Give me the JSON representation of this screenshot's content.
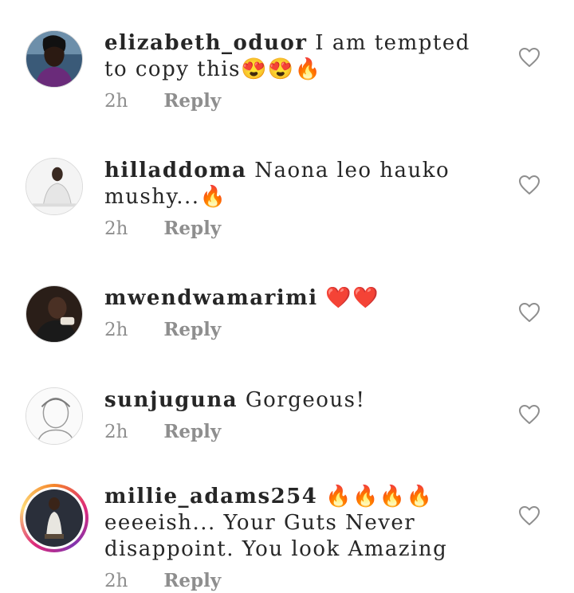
{
  "comments": [
    {
      "username": "elizabeth_oduor",
      "text": "I am tempted to copy this😍😍🔥",
      "time": "2h",
      "reply_label": "Reply",
      "avatar_icon": "profile-photo"
    },
    {
      "username": "hilladdoma",
      "text": "Naona leo hauko mushy...🔥",
      "time": "2h",
      "reply_label": "Reply",
      "avatar_icon": "profile-photo"
    },
    {
      "username": "mwendwamarimi",
      "text": "❤️❤️",
      "time": "2h",
      "reply_label": "Reply",
      "avatar_icon": "profile-photo"
    },
    {
      "username": "sunjuguna",
      "text": "Gorgeous!",
      "time": "2h",
      "reply_label": "Reply",
      "avatar_icon": "profile-photo"
    },
    {
      "username": "millie_adams254",
      "text": "🔥🔥🔥🔥eeeeish... Your Guts Never disappoint. You look Amazing",
      "time": "2h",
      "reply_label": "Reply",
      "avatar_icon": "profile-photo-story-ring"
    }
  ],
  "like_icon": "heart-outline-icon",
  "colors": {
    "text": "#262626",
    "secondary": "#8e8e8e",
    "ring_start": "#f58529",
    "ring_mid": "#dd2a7b",
    "ring_end": "#8134af"
  }
}
